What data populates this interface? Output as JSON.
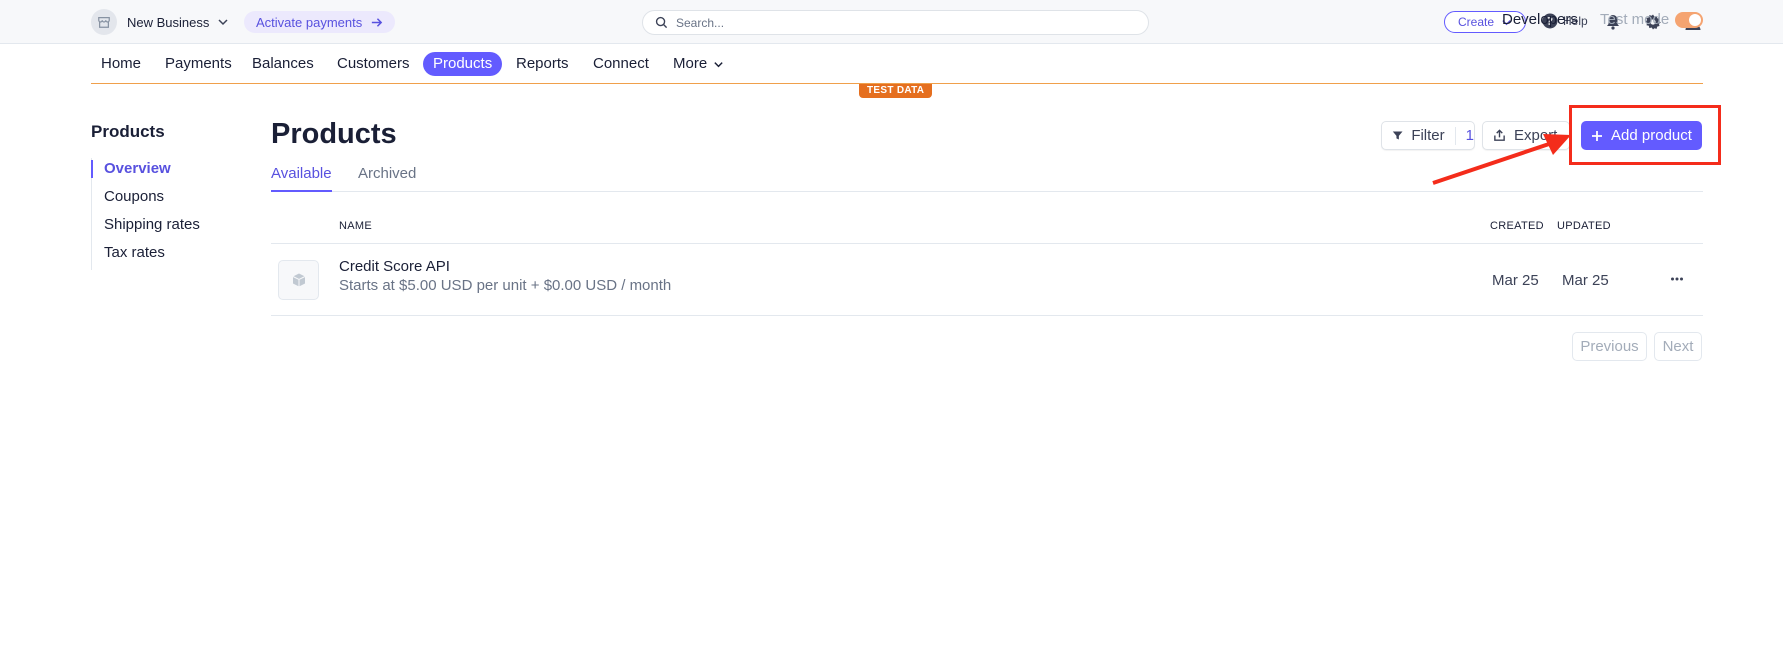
{
  "topbar": {
    "business_name": "New Business",
    "activate_label": "Activate payments",
    "search_placeholder": "Search...",
    "create_label": "Create",
    "help_label": "Help"
  },
  "nav": {
    "items": [
      {
        "label": "Home",
        "active": false
      },
      {
        "label": "Payments",
        "active": false
      },
      {
        "label": "Balances",
        "active": false
      },
      {
        "label": "Customers",
        "active": false
      },
      {
        "label": "Products",
        "active": true
      },
      {
        "label": "Reports",
        "active": false
      },
      {
        "label": "Connect",
        "active": false
      },
      {
        "label": "More",
        "active": false
      }
    ],
    "developers_label": "Developers",
    "test_mode_label": "Test mode",
    "test_mode_on": true,
    "test_data_badge": "TEST DATA"
  },
  "sidebar": {
    "title": "Products",
    "items": [
      {
        "label": "Overview",
        "active": true
      },
      {
        "label": "Coupons",
        "active": false
      },
      {
        "label": "Shipping rates",
        "active": false
      },
      {
        "label": "Tax rates",
        "active": false
      }
    ]
  },
  "main": {
    "title": "Products",
    "tabs": [
      {
        "label": "Available",
        "active": true
      },
      {
        "label": "Archived",
        "active": false
      }
    ],
    "filter_label": "Filter",
    "filter_count": "1",
    "export_label": "Export",
    "add_product_label": "Add product",
    "columns": {
      "name": "NAME",
      "created": "CREATED",
      "updated": "UPDATED"
    },
    "rows": [
      {
        "name": "Credit Score API",
        "description": "Starts at $5.00 USD per unit + $0.00 USD / month",
        "created": "Mar 25",
        "updated": "Mar 25"
      }
    ],
    "pagination": {
      "previous_label": "Previous",
      "next_label": "Next"
    }
  },
  "colors": {
    "accent": "#635bff",
    "test_mode": "#e56f1f",
    "annotation_red": "#f42c1b"
  }
}
